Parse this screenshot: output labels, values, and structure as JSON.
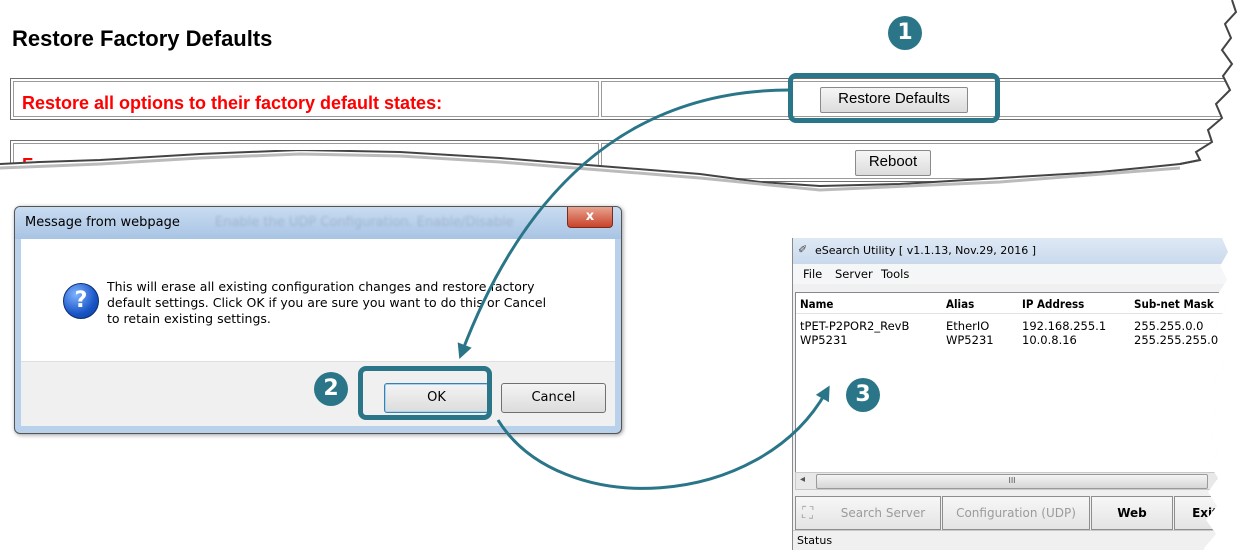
{
  "webpage": {
    "title": "Restore Factory Defaults",
    "row1_label": "Restore all options to their factory default states:",
    "row1_button": "Restore Defaults",
    "row2_label_fragment": "Force",
    "row2_button": "Reboot"
  },
  "dialog": {
    "title": "Message from webpage",
    "close_glyph": "x",
    "icon": "question-icon",
    "message_lines": [
      "This will erase all existing configuration changes and restore factory",
      "default settings. Click OK if you are sure you want to do this or Cancel",
      "to retain existing settings."
    ],
    "ok_label": "OK",
    "cancel_label": "Cancel",
    "background_ghost_text": "Enable the UDP Configuration. Enable/Disable"
  },
  "esearch": {
    "title": "eSearch Utility [ v1.1.13, Nov.29, 2016 ]",
    "menu": [
      "File",
      "Server",
      "Tools"
    ],
    "columns": [
      "Name",
      "Alias",
      "IP Address",
      "Sub-net Mask"
    ],
    "rows": [
      [
        "tPET-P2POR2_RevB",
        "EtherIO",
        "192.168.255.1",
        "255.255.0.0"
      ],
      [
        "WP5231",
        "WP5231",
        "10.0.8.16",
        "255.255.255.0"
      ]
    ],
    "scroll_thumb_glyph": "III",
    "buttons": {
      "search": "Search Server",
      "config": "Configuration (UDP)",
      "web": "Web",
      "exit": "Exit"
    },
    "status": "Status"
  },
  "annotations": {
    "step1": "1",
    "step2": "2",
    "step3": "3",
    "accent_color": "#2a7688"
  }
}
